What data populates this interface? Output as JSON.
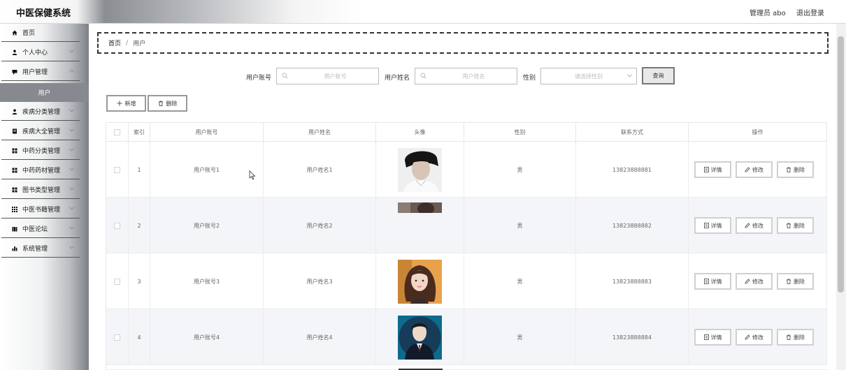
{
  "header": {
    "title": "中医保健系统",
    "user": "管理员 abo",
    "logout": "退出登录"
  },
  "sidebar": {
    "items": [
      {
        "label": "首页",
        "icon": "home-icon",
        "has_submenu": false
      },
      {
        "label": "个人中心",
        "icon": "person-icon",
        "has_submenu": true
      },
      {
        "label": "用户管理",
        "icon": "card-icon",
        "has_submenu": true
      },
      {
        "label": "疾病分类管理",
        "icon": "person-icon",
        "has_submenu": true
      },
      {
        "label": "疾病大全管理",
        "icon": "document-icon",
        "has_submenu": true
      },
      {
        "label": "中药分类管理",
        "icon": "grid-icon",
        "has_submenu": true
      },
      {
        "label": "中药药材管理",
        "icon": "grid-icon",
        "has_submenu": true
      },
      {
        "label": "图书类型管理",
        "icon": "grid-icon",
        "has_submenu": true
      },
      {
        "label": "中医书籍管理",
        "icon": "grid9-icon",
        "has_submenu": true
      },
      {
        "label": "中医论坛",
        "icon": "book-icon",
        "has_submenu": true
      },
      {
        "label": "系统管理",
        "icon": "bar-chart-icon",
        "has_submenu": true
      }
    ],
    "active_sub": "用户"
  },
  "breadcrumb": {
    "home": "首页",
    "sep": "/",
    "current": "用户"
  },
  "search": {
    "account_label": "用户账号",
    "account_placeholder": "用户账号",
    "name_label": "用户姓名",
    "name_placeholder": "用户姓名",
    "gender_label": "性别",
    "gender_placeholder": "请选择性别",
    "query_button": "查询"
  },
  "toolbar": {
    "add": "新增",
    "delete": "删除"
  },
  "table": {
    "headers": [
      "索引",
      "用户账号",
      "用户姓名",
      "头像",
      "性别",
      "联系方式",
      "操作"
    ],
    "actions": {
      "detail": "详情",
      "edit": "修改",
      "delete": "删除"
    },
    "rows": [
      {
        "index": "1",
        "account": "用户账号1",
        "name": "用户姓名1",
        "gender": "男",
        "phone": "13823888881",
        "avatar": "man-white-shirt"
      },
      {
        "index": "2",
        "account": "用户账号2",
        "name": "用户姓名2",
        "gender": "男",
        "phone": "13823888882",
        "avatar": "partial-strip"
      },
      {
        "index": "3",
        "account": "用户账号3",
        "name": "用户姓名3",
        "gender": "男",
        "phone": "13823888883",
        "avatar": "woman-long-hair"
      },
      {
        "index": "4",
        "account": "用户账号4",
        "name": "用户姓名4",
        "gender": "男",
        "phone": "13823888884",
        "avatar": "man-suit-blue"
      }
    ]
  },
  "colors": {
    "sidebar_active": "#868a90",
    "row_alt": "#f4f5f8"
  }
}
